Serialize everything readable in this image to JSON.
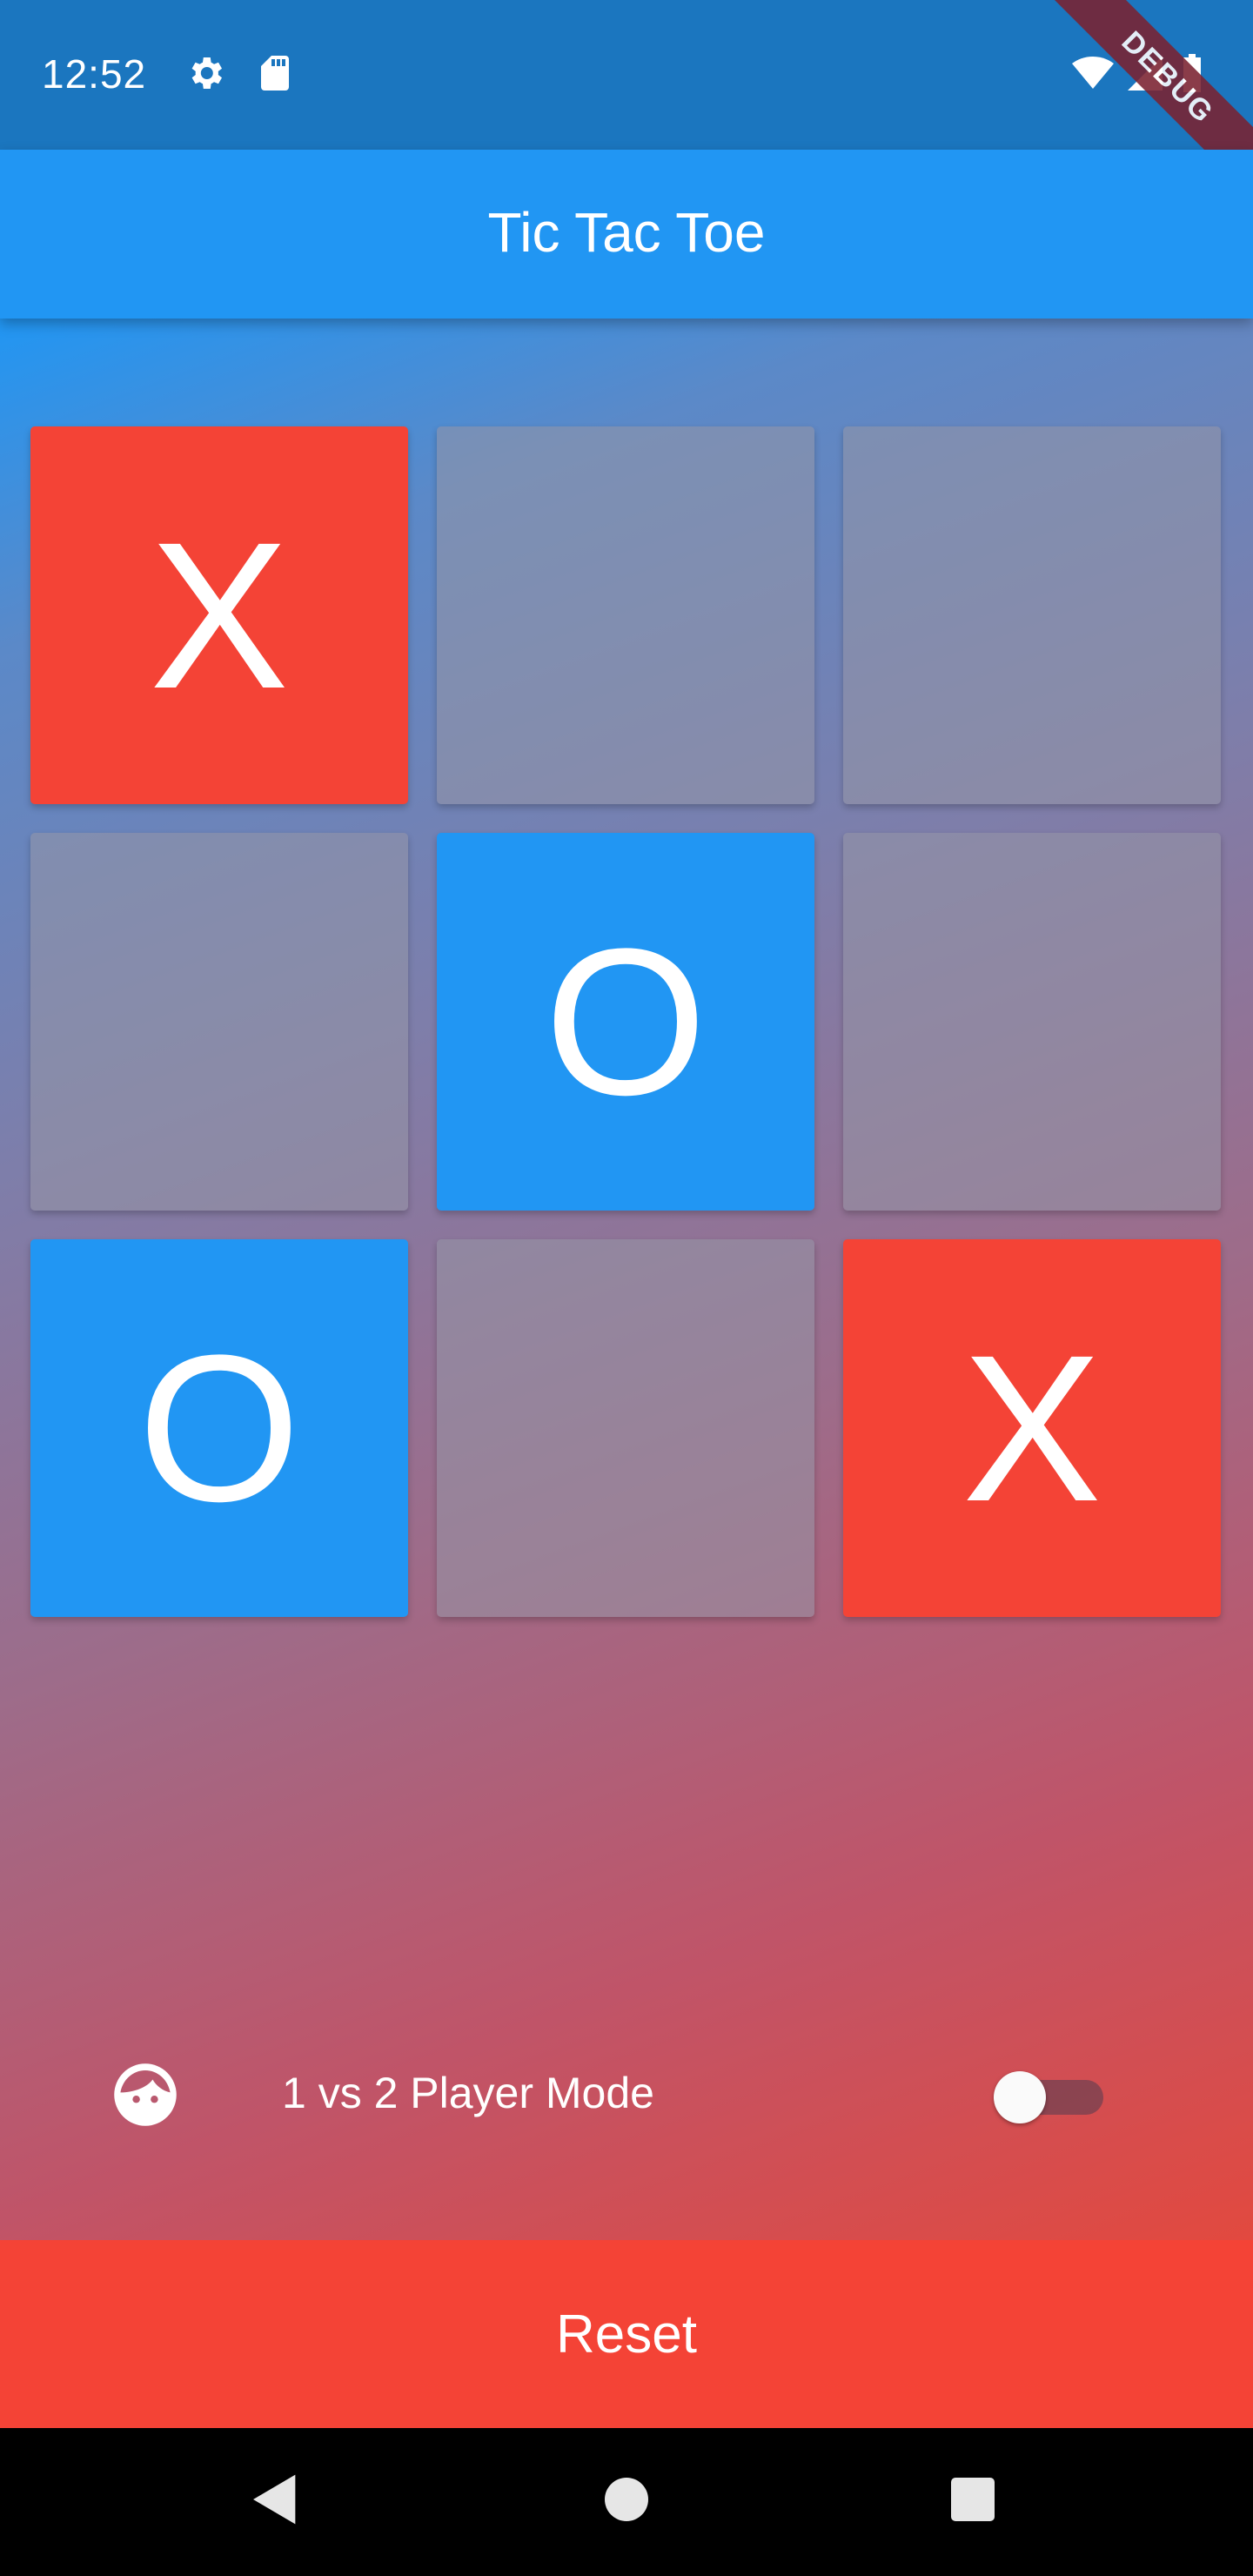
{
  "status_bar": {
    "time": "12:52",
    "icons": [
      "settings-icon",
      "sd-card-icon",
      "wifi-icon",
      "signal-icon",
      "battery-icon"
    ]
  },
  "debug_banner": "DEBUG",
  "app_bar": {
    "title": "Tic Tac Toe"
  },
  "board": {
    "cells": [
      "X",
      "",
      "",
      "",
      "O",
      "",
      "O",
      "",
      "X"
    ]
  },
  "mode": {
    "icon": "face-icon",
    "label": "1 vs 2 Player Mode",
    "toggle_on": false
  },
  "reset_label": "Reset",
  "colors": {
    "app_bar": "#2196f3",
    "status_bar": "#1b76bf",
    "x_cell": "#f44336",
    "o_cell": "#2196f3",
    "reset": "#f44336"
  },
  "nav_bar": {
    "buttons": [
      "back-icon",
      "home-icon",
      "recents-icon"
    ]
  }
}
